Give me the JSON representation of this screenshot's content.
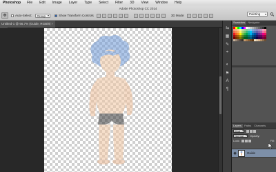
{
  "menubar": {
    "app_name": "Photoshop",
    "items": [
      "File",
      "Edit",
      "Image",
      "Layer",
      "Type",
      "Select",
      "Filter",
      "3D",
      "View",
      "Window",
      "Help"
    ]
  },
  "window": {
    "title": "Adobe Photoshop CC 2014"
  },
  "options": {
    "auto_select_label": "Auto-Select:",
    "auto_select_value": "Group",
    "show_transform_label": "Show Transform Controls",
    "mode_3d_label": "3D Mode:",
    "workspace_value": "Painting"
  },
  "document": {
    "tab_title": "Untitled-1 @ 66.7% (Guide, RGB/8)",
    "close_glyph": "×"
  },
  "panels": {
    "tabs_top": [
      "Swatches",
      "Navigator"
    ],
    "tabs_layers": [
      "Layers",
      "Paths",
      "Channels"
    ],
    "kind_value": "Kind",
    "blend_mode": "Normal",
    "opacity_label": "Opacity:",
    "lock_label": "Lock:",
    "fill_label": "Fill:",
    "layer_name": "Guide"
  },
  "swatch_colors": [
    "#ff0000",
    "#ffff00",
    "#00ff00",
    "#00ffff",
    "#0000ff",
    "#ff00ff",
    "#ffffff",
    "#e6e6e6",
    "#cccccc",
    "#b3b3b3",
    "#999999",
    "#808080",
    "#666666",
    "#4d4d4d",
    "#333333",
    "#000000",
    "#f7977a",
    "#f9ad81",
    "#fdc68a",
    "#fff79a",
    "#c4df9b",
    "#a2d39c",
    "#82ca9d",
    "#7bcdc8",
    "#6ecff6",
    "#7ea7d8",
    "#8493ca",
    "#8882be",
    "#a187be",
    "#bc8dbf",
    "#f49ac2",
    "#f6989d",
    "#f26c4f",
    "#f68e55",
    "#fbaf5c",
    "#fff467",
    "#acd372",
    "#7cc576",
    "#3bb878",
    "#1abbb4",
    "#00bff3",
    "#438cca",
    "#5574b9",
    "#605ca8",
    "#855fa8",
    "#a763a8",
    "#f06eaa",
    "#f26d7d",
    "#ed1c24",
    "#f26522",
    "#f7941d",
    "#fff200",
    "#8dc73f",
    "#39b54a",
    "#00a651",
    "#00a99d",
    "#00aeef",
    "#0072bc",
    "#0054a6",
    "#2e3192",
    "#662d91",
    "#92278f",
    "#ec008c",
    "#ed145b",
    "#9e0b0f",
    "#a0410d",
    "#a36209",
    "#aba000",
    "#598527",
    "#197b30",
    "#007236",
    "#00746b",
    "#0076a3",
    "#004b80",
    "#003471",
    "#1b1464",
    "#440e62",
    "#630460",
    "#9e005d",
    "#9e0039",
    "#790000",
    "#7b2e00",
    "#7d4900",
    "#827b00",
    "#406618",
    "#005e20",
    "#005826",
    "#005952",
    "#005b7f",
    "#003663",
    "#002157",
    "#0d004c",
    "#32004b",
    "#4b0049",
    "#7b0046",
    "#7a0026",
    "#c7b299",
    "#998675",
    "#736357",
    "#534741",
    "#37302d",
    "#c69c6d",
    "#a67c52",
    "#8c6239",
    "#754c24",
    "#603913",
    "#f2e1c4",
    "#e0c9a6",
    "#d8b48c",
    "#b89468",
    "#8c6f4e",
    "#6a4f35"
  ]
}
